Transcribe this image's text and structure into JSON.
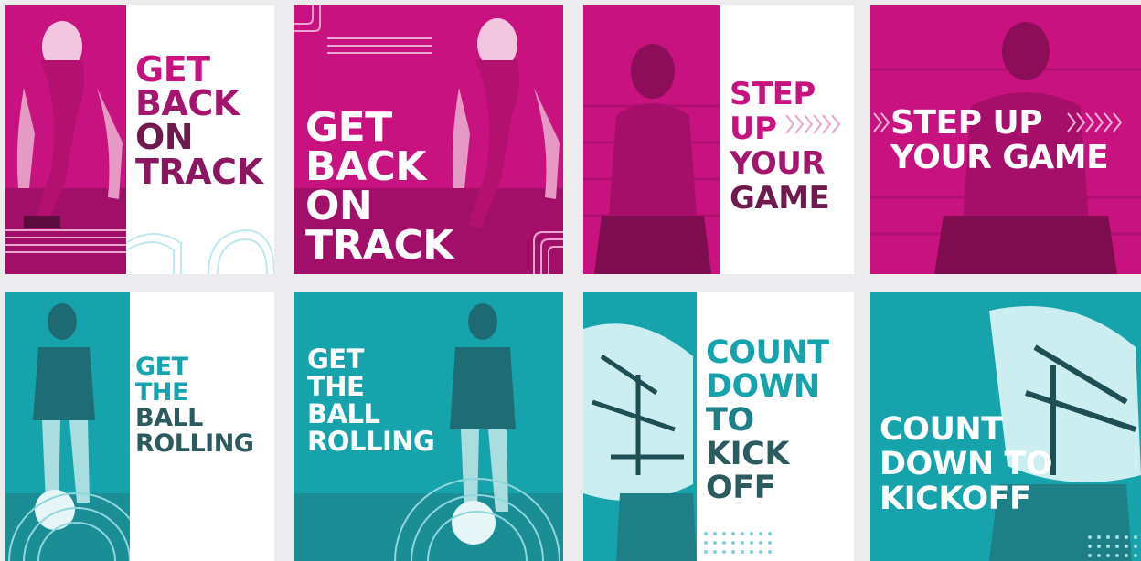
{
  "colors": {
    "magenta": "#c8127f",
    "magenta_dark": "#6e1a4e",
    "teal": "#17a3ac",
    "teal_dark": "#2c5b5f",
    "white": "#ffffff",
    "background": "#ececee"
  },
  "tiles": [
    {
      "theme": "magenta",
      "layout": "split",
      "headline": [
        "GET",
        "BACK",
        "ON",
        "TRACK"
      ],
      "photo": "sprinter-girl-crouching",
      "decoration": "track-lines"
    },
    {
      "theme": "magenta",
      "layout": "full",
      "headline": [
        "GET",
        "BACK",
        "ON",
        "TRACK"
      ],
      "photo": "sprinter-girl-crouching",
      "decoration": "track-lines"
    },
    {
      "theme": "magenta",
      "layout": "split",
      "headline": [
        "STEP",
        "UP",
        "YOUR",
        "GAME"
      ],
      "photo": "boy-sitting-on-bleachers",
      "decoration": "chevrons"
    },
    {
      "theme": "magenta",
      "layout": "full",
      "headline": [
        "STEP UP",
        "YOUR GAME"
      ],
      "photo": "boy-sitting-on-bleachers",
      "decoration": "chevrons"
    },
    {
      "theme": "teal",
      "layout": "split",
      "headline": [
        "GET",
        "THE",
        "BALL",
        "ROLLING"
      ],
      "photo": "girl-with-soccer-ball",
      "decoration": "concentric-arcs"
    },
    {
      "theme": "teal",
      "layout": "full",
      "headline": [
        "GET",
        "THE",
        "BALL",
        "ROLLING"
      ],
      "photo": "girl-with-soccer-ball",
      "decoration": "concentric-arcs"
    },
    {
      "theme": "teal",
      "layout": "split",
      "headline": [
        "COUNT",
        "DOWN",
        "TO",
        "KICK",
        "OFF"
      ],
      "photo": "football-helmet",
      "decoration": "dot-triangles"
    },
    {
      "theme": "teal",
      "layout": "full",
      "headline": [
        "COUNT",
        "DOWN TO",
        "KICKOFF"
      ],
      "photo": "football-helmet",
      "decoration": "dot-triangles"
    }
  ]
}
